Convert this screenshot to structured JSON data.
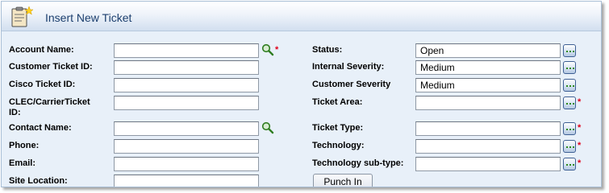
{
  "header": {
    "title": "Insert New Ticket",
    "icon": "clipboard-new-icon"
  },
  "left_fields": [
    {
      "label": "Account Name:",
      "value": "",
      "lookup": true,
      "required": true
    },
    {
      "label": "Customer Ticket ID:",
      "value": ""
    },
    {
      "label": "Cisco Ticket ID:",
      "value": ""
    },
    {
      "label_line1": "CLEC/CarrierTicket",
      "label_line2": "ID:",
      "value": ""
    },
    {
      "label": "Contact Name:",
      "value": "",
      "lookup": true
    },
    {
      "label": "Phone:",
      "value": ""
    },
    {
      "label": "Email:",
      "value": ""
    },
    {
      "label": "Site Location:",
      "value": ""
    }
  ],
  "right_fields": [
    {
      "label": "Status:",
      "value": "Open"
    },
    {
      "label": "Internal Severity:",
      "value": "Medium"
    },
    {
      "label": "Customer Severity",
      "value": "Medium"
    },
    {
      "label": "Ticket Area:",
      "value": "",
      "required": true
    },
    {
      "label": "Ticket Type:",
      "value": "",
      "required": true
    },
    {
      "label": "Technology:",
      "value": "",
      "required": true
    },
    {
      "label": "Technology sub-type:",
      "value": "",
      "required": true
    }
  ],
  "required_marker": "*",
  "punch_in_label": "Punch In",
  "colors": {
    "panel_bg": "#e8f0f9",
    "title": "#1c3f6e",
    "required": "#e0001a"
  }
}
